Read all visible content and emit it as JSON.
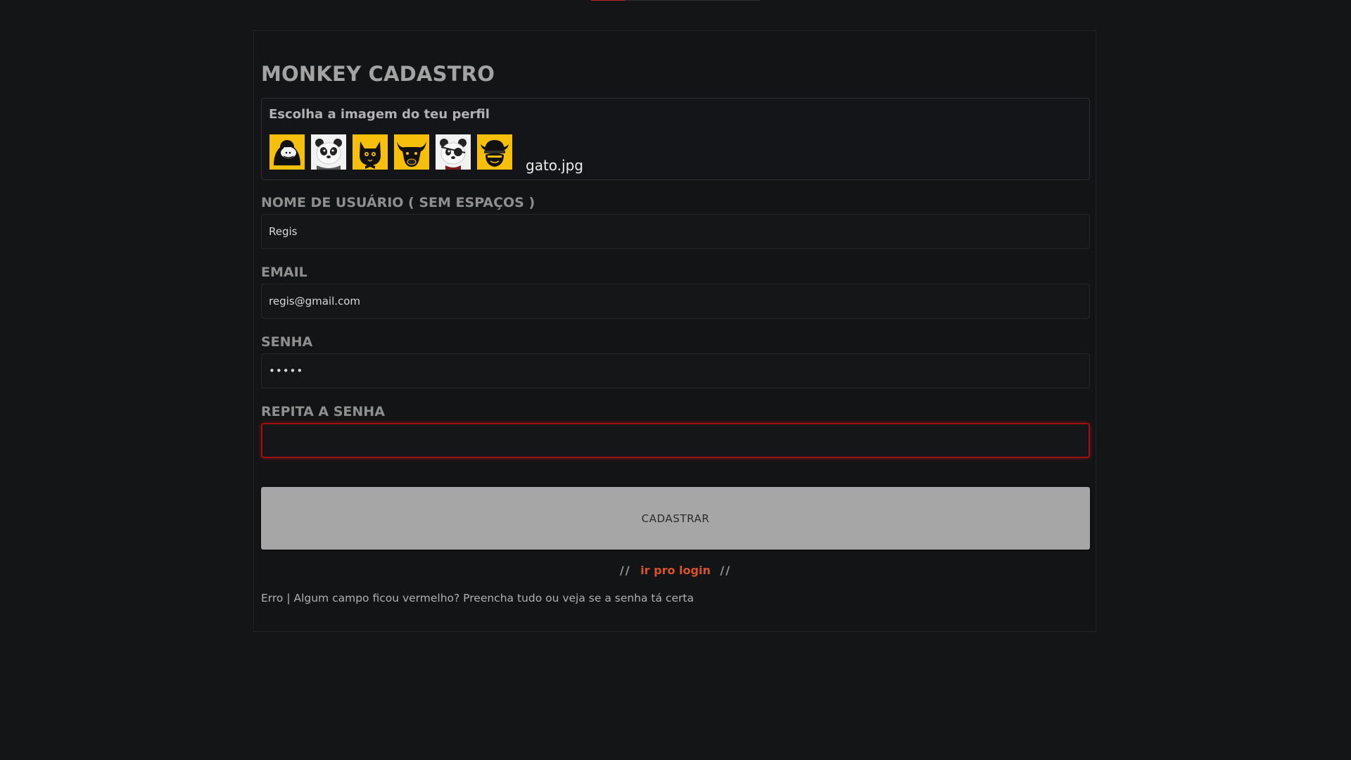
{
  "page": {
    "title": "MONKEY CADASTRO"
  },
  "avatar_picker": {
    "label": "Escolha a imagem do teu perfil",
    "options": [
      {
        "icon": "gorilla-icon",
        "color": "#f6bf0b"
      },
      {
        "icon": "panda-icon",
        "color": "#f2f2f2"
      },
      {
        "icon": "cat-icon",
        "color": "#f6bf0b"
      },
      {
        "icon": "bull-icon",
        "color": "#f6bf0b"
      },
      {
        "icon": "pirate-panda-icon",
        "color": "#f2f2f2"
      },
      {
        "icon": "viking-icon",
        "color": "#f6bf0b"
      }
    ],
    "selected_file": "gato.jpg"
  },
  "form": {
    "username_label": "NOME DE USUÁRIO ( SEM ESPAÇOS )",
    "username_value": "Regis",
    "email_label": "EMAIL",
    "email_value": "regis@gmail.com",
    "password_label": "SENHA",
    "password_value": "12345",
    "repeat_password_label": "REPITA A SENHA",
    "repeat_password_value": "",
    "submit_label": "CADASTRAR"
  },
  "login": {
    "separator_left": "//",
    "link_label": "ir pro login",
    "separator_right": "//"
  },
  "status": {
    "error_message": "Erro | Algum campo ficou vermelho? Preencha tudo ou veja se a senha tá certa"
  },
  "colors": {
    "background": "#141517",
    "accent": "#d9542b",
    "error_border": "#9e1111",
    "avatar_yellow": "#f6bf0b"
  }
}
